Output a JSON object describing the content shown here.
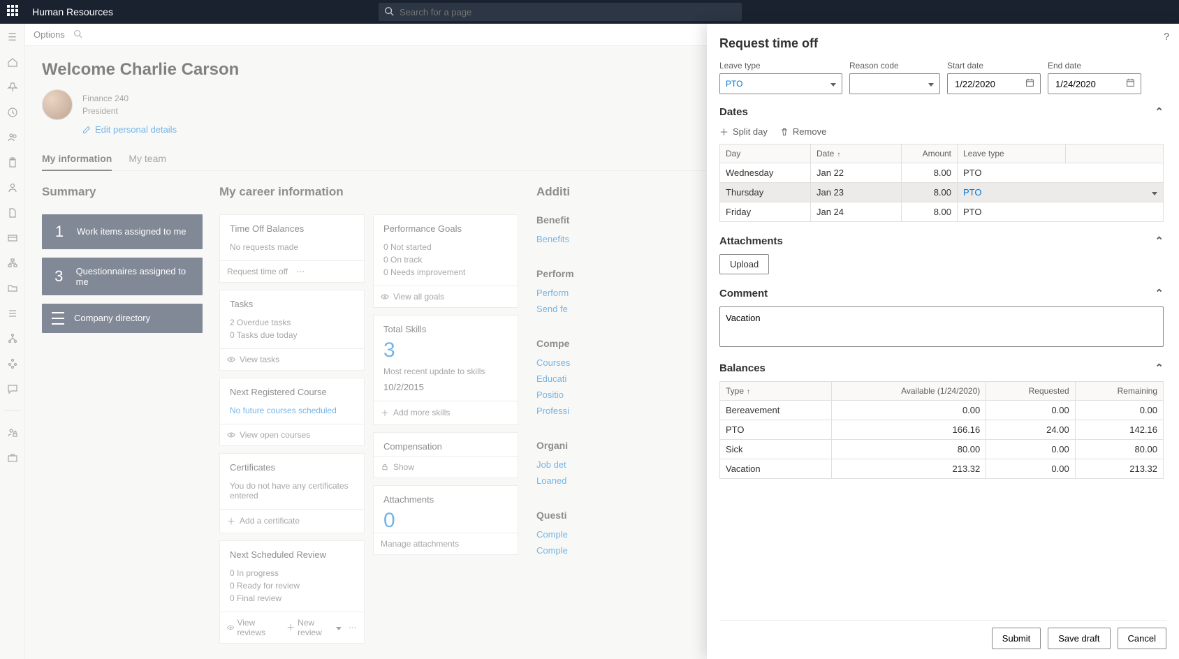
{
  "topbar": {
    "title": "Human Resources",
    "search_placeholder": "Search for a page"
  },
  "optionsbar": {
    "options": "Options"
  },
  "welcome": "Welcome Charlie Carson",
  "profile": {
    "dept": "Finance 240",
    "role": "President",
    "edit": "Edit personal details"
  },
  "tabs": {
    "myinfo": "My information",
    "myteam": "My team"
  },
  "summary": {
    "heading": "Summary",
    "tiles": [
      {
        "num": "1",
        "label": "Work items assigned to me"
      },
      {
        "num": "3",
        "label": "Questionnaires assigned to me"
      },
      {
        "num": "",
        "label": "Company directory"
      }
    ]
  },
  "career": {
    "heading": "My career information",
    "timeoff": {
      "title": "Time Off Balances",
      "body": "No requests made",
      "action": "Request time off"
    },
    "tasks": {
      "title": "Tasks",
      "l1": "2 Overdue tasks",
      "l2": "0 Tasks due today",
      "action": "View tasks"
    },
    "course": {
      "title": "Next Registered Course",
      "body": "No future courses scheduled",
      "action": "View open courses"
    },
    "certs": {
      "title": "Certificates",
      "body": "You do not have any certificates entered",
      "action": "Add a certificate"
    },
    "review": {
      "title": "Next Scheduled Review",
      "l1": "0 In progress",
      "l2": "0 Ready for review",
      "l3": "0 Final review",
      "a1": "View reviews",
      "a2": "New review"
    },
    "perf": {
      "title": "Performance Goals",
      "l1": "0 Not started",
      "l2": "0 On track",
      "l3": "0 Needs improvement",
      "action": "View all goals"
    },
    "skills": {
      "title": "Total Skills",
      "num": "3",
      "sub": "Most recent update to skills",
      "date": "10/2/2015",
      "action": "Add more skills"
    },
    "comp": {
      "title": "Compensation",
      "action": "Show"
    },
    "attach": {
      "title": "Attachments",
      "num": "0",
      "action": "Manage attachments"
    }
  },
  "additional": {
    "heading": "Additi",
    "benefits": {
      "h": "Benefit",
      "l1": "Benefits"
    },
    "perform": {
      "h": "Perform",
      "l1": "Perform",
      "l2": "Send fe"
    },
    "compet": {
      "h": "Compe",
      "l1": "Courses",
      "l2": "Educati",
      "l3": "Positio",
      "l4": "Professi"
    },
    "org": {
      "h": "Organi",
      "l1": "Job det",
      "l2": "Loaned"
    },
    "quest": {
      "h": "Questi",
      "l1": "Comple",
      "l2": "Comple"
    }
  },
  "panel": {
    "title": "Request time off",
    "leave_type_lbl": "Leave type",
    "leave_type_val": "PTO",
    "reason_lbl": "Reason code",
    "reason_val": "",
    "start_lbl": "Start date",
    "start_val": "1/22/2020",
    "end_lbl": "End date",
    "end_val": "1/24/2020",
    "dates_h": "Dates",
    "split": "Split day",
    "remove": "Remove",
    "cols": {
      "day": "Day",
      "date": "Date",
      "amount": "Amount",
      "leave": "Leave type"
    },
    "rows": [
      {
        "day": "Wednesday",
        "date": "Jan 22",
        "amount": "8.00",
        "leave": "PTO"
      },
      {
        "day": "Thursday",
        "date": "Jan 23",
        "amount": "8.00",
        "leave": "PTO"
      },
      {
        "day": "Friday",
        "date": "Jan 24",
        "amount": "8.00",
        "leave": "PTO"
      }
    ],
    "attach_h": "Attachments",
    "upload": "Upload",
    "comment_h": "Comment",
    "comment_val": "Vacation",
    "balances_h": "Balances",
    "bcols": {
      "type": "Type",
      "avail": "Available (1/24/2020)",
      "req": "Requested",
      "rem": "Remaining"
    },
    "brows": [
      {
        "t": "Bereavement",
        "a": "0.00",
        "r": "0.00",
        "m": "0.00"
      },
      {
        "t": "PTO",
        "a": "166.16",
        "r": "24.00",
        "m": "142.16"
      },
      {
        "t": "Sick",
        "a": "80.00",
        "r": "0.00",
        "m": "80.00"
      },
      {
        "t": "Vacation",
        "a": "213.32",
        "r": "0.00",
        "m": "213.32"
      }
    ],
    "submit": "Submit",
    "savedraft": "Save draft",
    "cancel": "Cancel"
  }
}
